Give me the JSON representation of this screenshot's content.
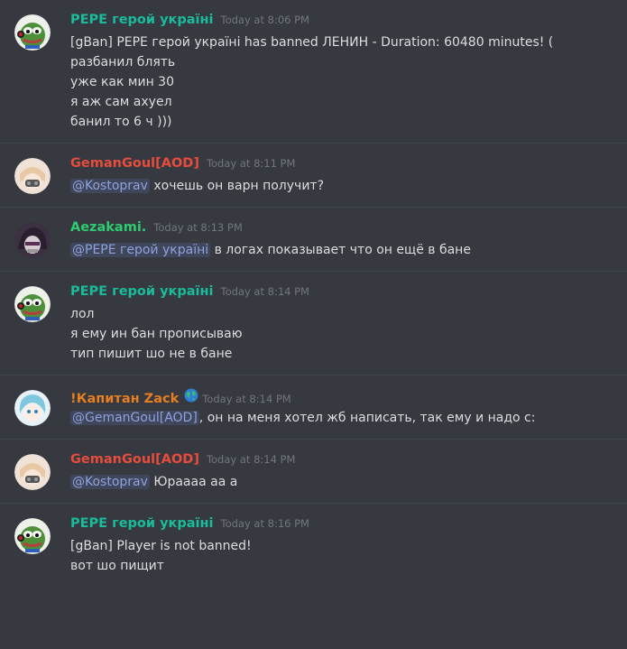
{
  "colors": {
    "pepe": "#1abc9c",
    "geman": "#e74c3c",
    "aezakami": "#2ecc71",
    "zack": "#e67e22"
  },
  "messages": [
    {
      "author": "PEPE герой україні",
      "timestamp": "Today at 8:06 PM",
      "avatar": "pepe-avatar",
      "lines": [
        "[gBan] PEPE герой україні has banned ЛЕНИН - Duration: 60480 minutes! (",
        "разбанил блять",
        "уже как мин 30",
        "я аж сам ахуел",
        "банил то 6 ч )))"
      ]
    },
    {
      "author": "GemanGoul[AOD]",
      "timestamp": "Today at 8:11 PM",
      "avatar": "geman-avatar",
      "mention": "@Kostoprav",
      "text": " хочешь он варн получит?"
    },
    {
      "author": "Aezakami.",
      "timestamp": "Today at 8:13 PM",
      "avatar": "aezakami-avatar",
      "mention": "@PEPE герой україні",
      "text": " в логах показывает что он ещё в бане"
    },
    {
      "author": "PEPE герой україні",
      "timestamp": "Today at 8:14 PM",
      "avatar": "pepe-avatar",
      "lines": [
        "лол",
        "я ему ин бан прописываю",
        "тип пишит шо не в бане"
      ]
    },
    {
      "author": "!Капитан Zack",
      "timestamp": "Today at 8:14 PM",
      "avatar": "zack-avatar",
      "badge": "globe-icon",
      "mention": "@GemanGoul[AOD]",
      "text": ", он на меня хотел жб написать, так ему и надо с:"
    },
    {
      "author": "GemanGoul[AOD]",
      "timestamp": "Today at 8:14 PM",
      "avatar": "geman-avatar",
      "mention": "@Kostoprav",
      "text": " Юраааа аа а"
    },
    {
      "author": "PEPE герой україні",
      "timestamp": "Today at 8:16 PM",
      "avatar": "pepe-avatar",
      "lines": [
        "[gBan] Player is not banned!",
        "вот шо пищит"
      ]
    }
  ]
}
